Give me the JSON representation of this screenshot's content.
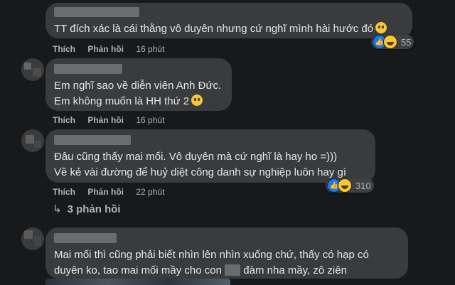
{
  "comments": [
    {
      "lines": [
        "TT đích xác là cái thằng vô duyên nhưng cứ nghĩ mình hài hước đó"
      ],
      "like_label": "Thích",
      "reply_label": "Phản hồi",
      "time": "16 phút",
      "reactions": {
        "icons": [
          "like-icon",
          "haha-icon"
        ],
        "count": "55"
      }
    },
    {
      "lines": [
        "Em nghĩ sao về diễn viên Anh Đức.",
        "Em không muốn là HH thứ 2"
      ],
      "like_label": "Thích",
      "reply_label": "Phản hồi",
      "time": "16 phút"
    },
    {
      "lines": [
        "Đâu cũng thấy mai mối. Vô duyên mà cứ nghĩ là hay ho =)))",
        "Về kẻ vài đường để huỷ diệt công danh sự nghiệp luôn hay gì"
      ],
      "like_label": "Thích",
      "reply_label": "Phản hồi",
      "time": "22 phút",
      "reactions": {
        "icons": [
          "like-icon",
          "haha-icon"
        ],
        "count": "310"
      },
      "replies_label": "3 phản hồi"
    },
    {
      "line1": "Mai mối thì cũng phải biết nhìn lên nhìn xuống chứ, thấy có hạp có",
      "line2_pre": "duyên ko, tao mai mối mầy cho con",
      "line2_post": "đàm nha mầy, zô ziên"
    }
  ],
  "colors": {
    "background": "#18191a",
    "bubble": "#3a3b3c",
    "text": "#e4e6eb",
    "meta": "#b0b3b8",
    "like": "#1877f2"
  }
}
